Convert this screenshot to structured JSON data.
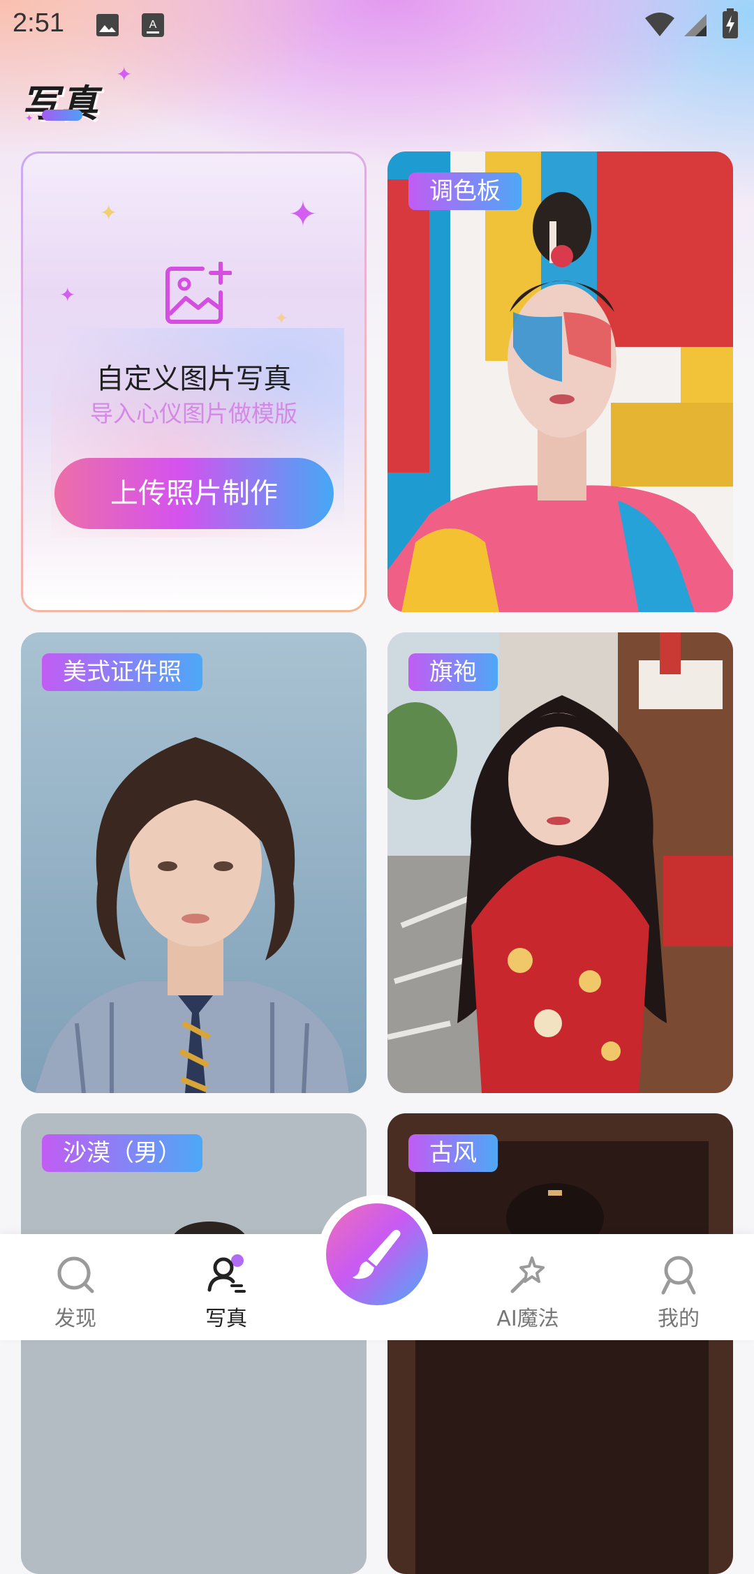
{
  "status_bar": {
    "time": "2:51",
    "icons": [
      "image-notification-icon",
      "keyboard-notification-icon",
      "wifi-icon",
      "signal-icon",
      "battery-charging-icon"
    ]
  },
  "header": {
    "title": "写真"
  },
  "custom_card": {
    "title": "自定义图片写真",
    "subtitle": "导入心仪图片做模版",
    "button_label": "上传照片制作",
    "icon": "add-image-icon"
  },
  "templates": [
    {
      "tag": "调色板",
      "image": "paint-splatter-portrait"
    },
    {
      "tag": "美式证件照",
      "image": "curly-hair-id-photo"
    },
    {
      "tag": "旗袍",
      "image": "red-qipao-street-portrait"
    },
    {
      "tag": "沙漠（男）",
      "image": "desert-man-portrait"
    },
    {
      "tag": "古风",
      "image": "ancient-style-portrait"
    }
  ],
  "nav": [
    {
      "label": "发现",
      "icon": "search-icon"
    },
    {
      "label": "写真",
      "icon": "portrait-icon",
      "active": true
    },
    {
      "label": "AI魔法",
      "icon": "magic-wand-icon"
    },
    {
      "label": "我的",
      "icon": "profile-icon"
    }
  ],
  "fab": {
    "icon": "brush-icon"
  },
  "colors": {
    "accent_pink": "#ec6fa6",
    "accent_purple": "#c95af2",
    "accent_blue": "#45a8f5",
    "subtitle_pink": "#d489e6"
  }
}
